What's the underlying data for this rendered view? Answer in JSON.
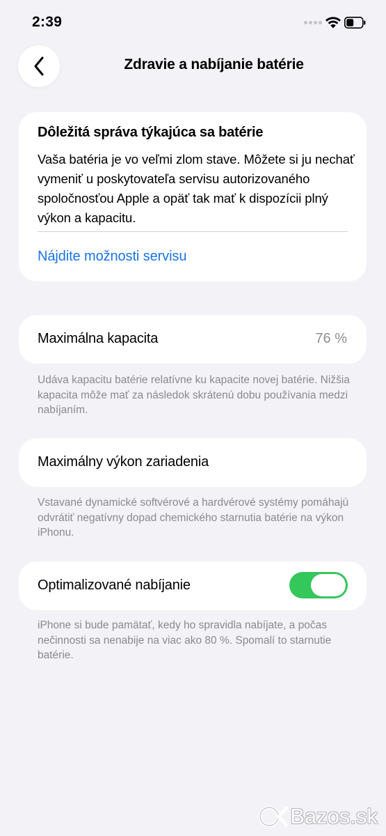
{
  "status_bar": {
    "time": "2:39",
    "icons": [
      "signal-dots-icon",
      "wifi-icon",
      "battery-icon"
    ]
  },
  "nav": {
    "back_icon": "chevron-left-icon",
    "title": "Zdravie a nabíjanie batérie"
  },
  "alert": {
    "title": "Dôležitá správa týkajúca sa batérie",
    "body": "Vaša batéria je vo veľmi zlom stave. Môžete si ju nechať vymeniť u poskytovateľa servisu autorizovaného spoločnosťou Apple a opäť tak mať k dispozícii plný výkon a kapacitu.",
    "link": "Nájdite možnosti servisu"
  },
  "max_capacity": {
    "label": "Maximálna kapacita",
    "value": "76 %",
    "footnote": "Udáva kapacitu batérie relatívne ku kapacite novej batérie. Nižšia kapacita môže mať za následok skrátenú dobu používania medzi nabíjaním."
  },
  "peak_performance": {
    "label": "Maximálny výkon zariadenia",
    "footnote": "Vstavané dynamické softvérové a hardvérové systémy pomáhajú odvrátiť negatívny dopad chemického starnutia batérie na výkon iPhonu."
  },
  "optimized_charging": {
    "label": "Optimalizované nabíjanie",
    "enabled": true,
    "footnote": "iPhone si bude pamätať, kedy ho spravidla nabíjate, a počas nečinnosti sa nenabije na viac ako 80 %. Spomalí to starnutie batérie."
  },
  "colors": {
    "background": "#f2f2f7",
    "link": "#1a73e8",
    "toggle_on": "#34c759",
    "secondary_text": "#8e8e93"
  },
  "watermark": {
    "text": "Bazos.sk"
  }
}
